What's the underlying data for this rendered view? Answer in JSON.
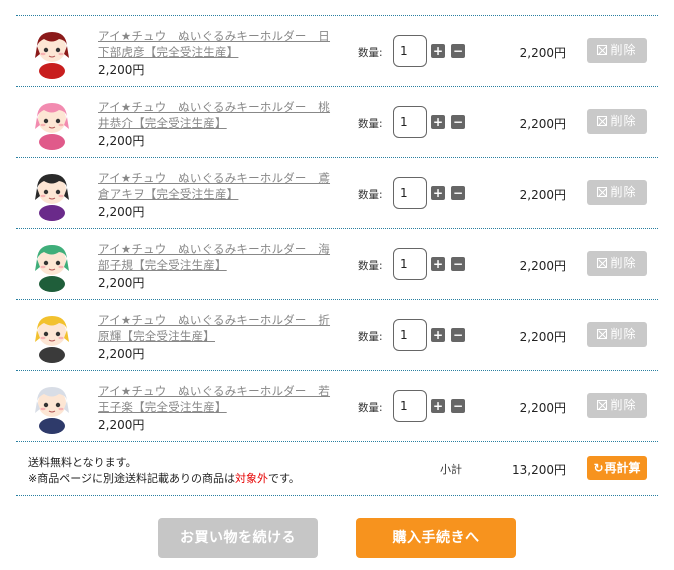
{
  "cart": {
    "qty_label": "数量:",
    "delete_label": "削除",
    "items": [
      {
        "name": "アイ★チュウ　ぬいぐるみキーホルダー　日下部虎彦【完全受注生産】",
        "price": "2,200円",
        "qty": "1",
        "total": "2,200円",
        "hair_color": "#8b1a1a",
        "outfit_color": "#c81e1e"
      },
      {
        "name": "アイ★チュウ　ぬいぐるみキーホルダー　桃井恭介【完全受注生産】",
        "price": "2,200円",
        "qty": "1",
        "total": "2,200円",
        "hair_color": "#f28bb0",
        "outfit_color": "#e05a8a"
      },
      {
        "name": "アイ★チュウ　ぬいぐるみキーホルダー　鳶倉アキヲ【完全受注生産】",
        "price": "2,200円",
        "qty": "1",
        "total": "2,200円",
        "hair_color": "#2a2a2a",
        "outfit_color": "#6a2a8a"
      },
      {
        "name": "アイ★チュウ　ぬいぐるみキーホルダー　海部子規【完全受注生産】",
        "price": "2,200円",
        "qty": "1",
        "total": "2,200円",
        "hair_color": "#3fae7a",
        "outfit_color": "#1f5e3a"
      },
      {
        "name": "アイ★チュウ　ぬいぐるみキーホルダー　折原輝【完全受注生産】",
        "price": "2,200円",
        "qty": "1",
        "total": "2,200円",
        "hair_color": "#f2c12e",
        "outfit_color": "#3a3a3a"
      },
      {
        "name": "アイ★チュウ　ぬいぐるみキーホルダー　若王子楽【完全受注生産】",
        "price": "2,200円",
        "qty": "1",
        "total": "2,200円",
        "hair_color": "#d8dde6",
        "outfit_color": "#2e3a6a"
      }
    ]
  },
  "summary": {
    "ship_line1": "送料無料となります。",
    "ship_line2_before": "※商品ページに別途送料記載ありの商品は",
    "ship_line2_red": "対象外",
    "ship_line2_after": "です。",
    "subtotal_label": "小計",
    "subtotal_value": "13,200円",
    "recalc_icon": "↻",
    "recalc_label": "再計算"
  },
  "actions": {
    "continue_label": "お買い物を続ける",
    "checkout_label": "購入手続きへ"
  },
  "colors": {
    "accent": "#f7931e",
    "muted_button": "#c6c6c6",
    "divider": "#2a7fa0",
    "warning_red": "#e60000"
  },
  "icons": {
    "plus": "+",
    "minus": "−"
  }
}
